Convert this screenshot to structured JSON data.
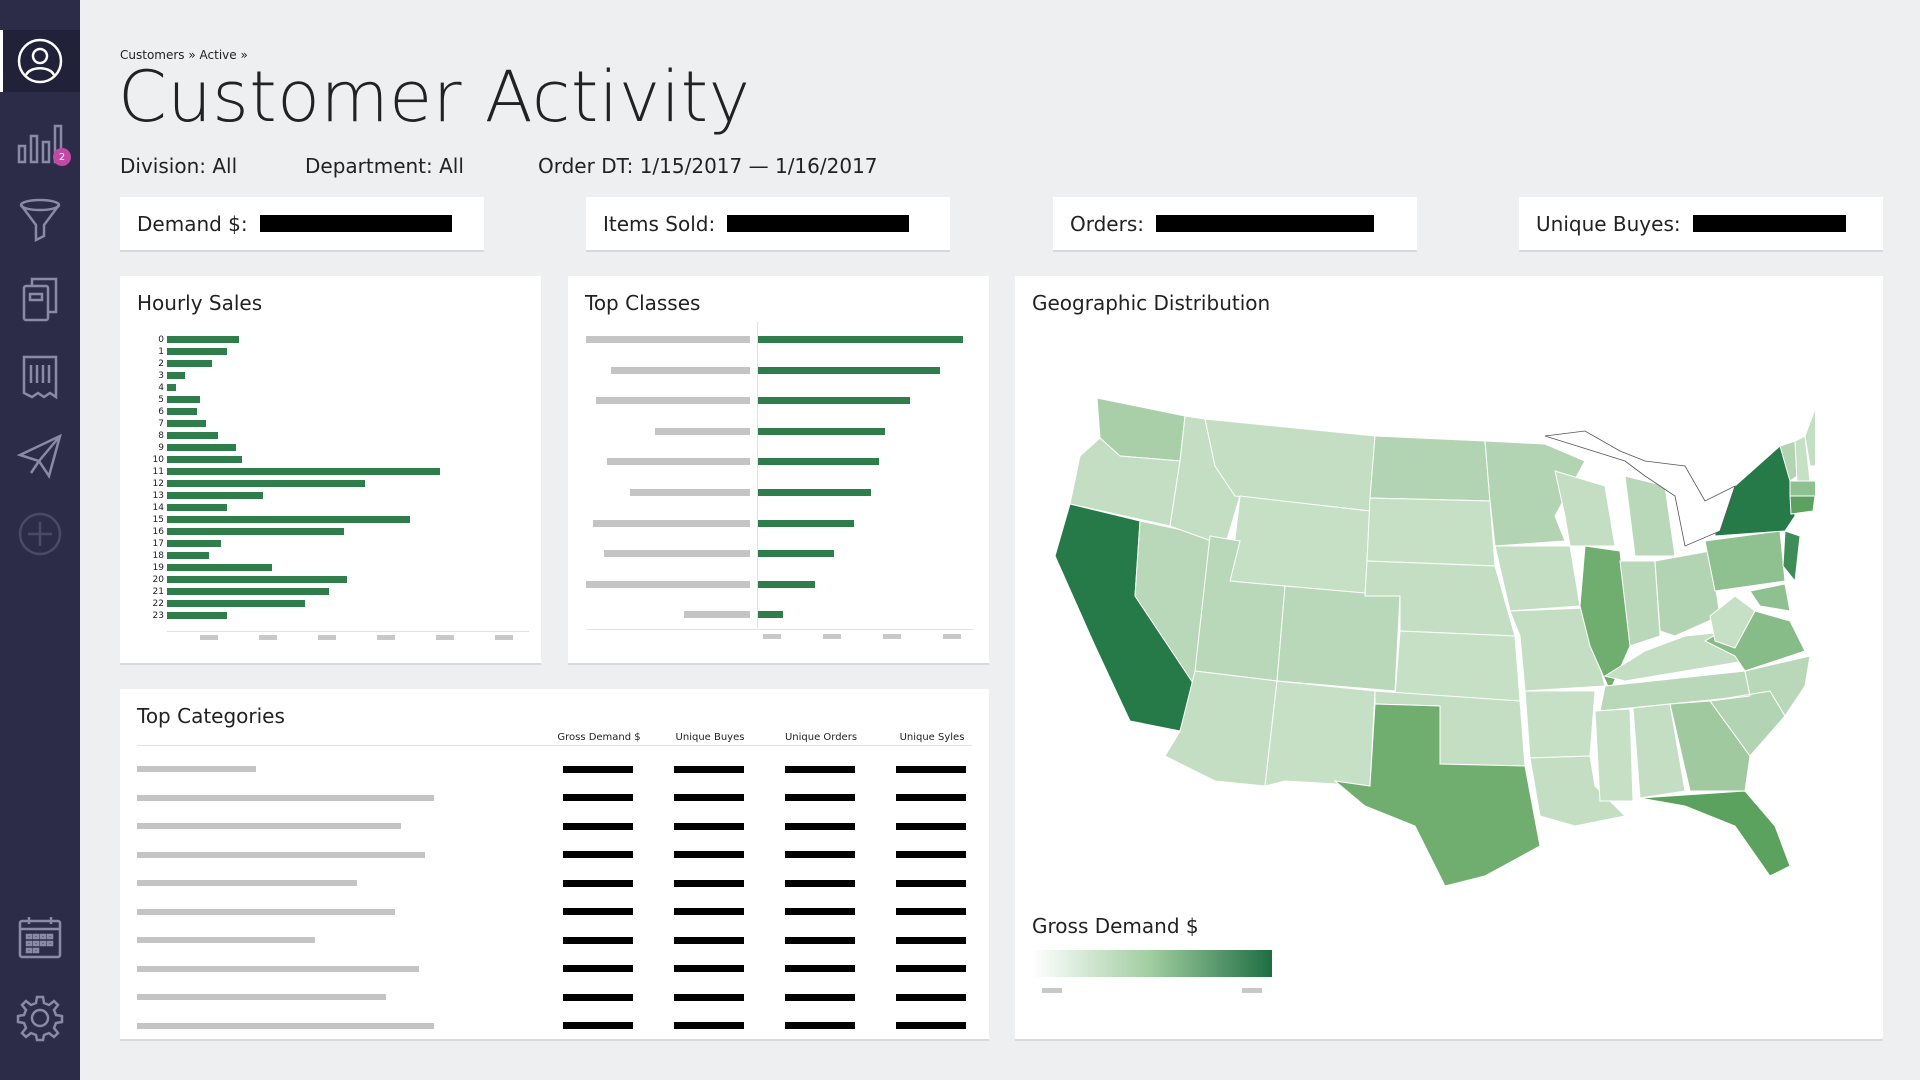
{
  "breadcrumb": "Customers » Active »",
  "title": "Customer Activity",
  "filters": {
    "division": "Division: All",
    "department": "Department: All",
    "order_dt": "Order DT: 1/15/2017 — 1/16/2017"
  },
  "nav": {
    "items": [
      "profile-icon",
      "chart-icon",
      "funnel-icon",
      "documents-icon",
      "receipt-icon",
      "send-icon",
      "add-icon",
      "calendar-icon",
      "gear-icon"
    ],
    "badge": "2"
  },
  "kpis": {
    "demand": "Demand $:",
    "items_sold": "Items Sold:",
    "orders": "Orders:",
    "unique_buyes": "Unique Buyes:"
  },
  "hourly": {
    "title": "Hourly Sales",
    "chart_data": {
      "type": "bar",
      "orientation": "horizontal",
      "categories": [
        "0",
        "1",
        "2",
        "3",
        "4",
        "5",
        "6",
        "7",
        "8",
        "9",
        "10",
        "11",
        "12",
        "13",
        "14",
        "15",
        "16",
        "17",
        "18",
        "19",
        "20",
        "21",
        "22",
        "23"
      ],
      "values": [
        24,
        20,
        15,
        6,
        3,
        11,
        10,
        13,
        17,
        23,
        25,
        91,
        66,
        32,
        20,
        81,
        59,
        18,
        14,
        35,
        60,
        54,
        46,
        20
      ],
      "grid": false
    }
  },
  "top_classes": {
    "title": "Top Classes",
    "chart_data": {
      "type": "bar",
      "orientation": "horizontal",
      "series": [
        {
          "values": [
            100,
            89,
            74,
            62,
            59,
            55,
            47,
            37,
            28,
            12
          ]
        }
      ],
      "category_label_lengths": [
        100,
        85,
        94,
        58,
        87,
        73,
        96,
        89,
        100,
        40
      ]
    }
  },
  "top_categories": {
    "title": "Top Categories",
    "columns": [
      "Gross Demand $",
      "Unique Buyes",
      "Unique Orders",
      "Unique Syles"
    ],
    "row_count": 10,
    "name_lengths": [
      40,
      100,
      89,
      97,
      74,
      87,
      60,
      95,
      84,
      100
    ]
  },
  "geo": {
    "title": "Geographic Distribution",
    "legend_title": "Gross Demand $",
    "colors": {
      "low": "#ffffff",
      "mid": "#9fcc9f",
      "high": "#1e6e42"
    }
  }
}
